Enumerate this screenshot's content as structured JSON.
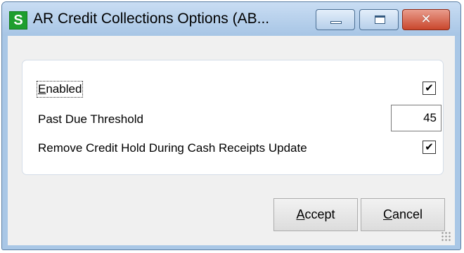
{
  "window": {
    "title": "AR Credit Collections Options (AB...",
    "app_icon_letter": "S",
    "close_glyph": "✕"
  },
  "options": {
    "enabled": {
      "label_first": "E",
      "label_rest": "nabled",
      "checked": true,
      "check_glyph": "✔"
    },
    "past_due_threshold": {
      "label": "Past Due Threshold",
      "value": "45"
    },
    "remove_credit_hold": {
      "label": "Remove Credit Hold During Cash Receipts Update",
      "checked": true,
      "check_glyph": "✔"
    }
  },
  "buttons": {
    "accept": {
      "mnemonic": "A",
      "rest": "ccept"
    },
    "cancel": {
      "mnemonic": "C",
      "rest": "ancel"
    }
  },
  "colors": {
    "app_icon": "#1e9e2e",
    "titlebar": "#a9c7e6",
    "close_button": "#c9462c"
  }
}
